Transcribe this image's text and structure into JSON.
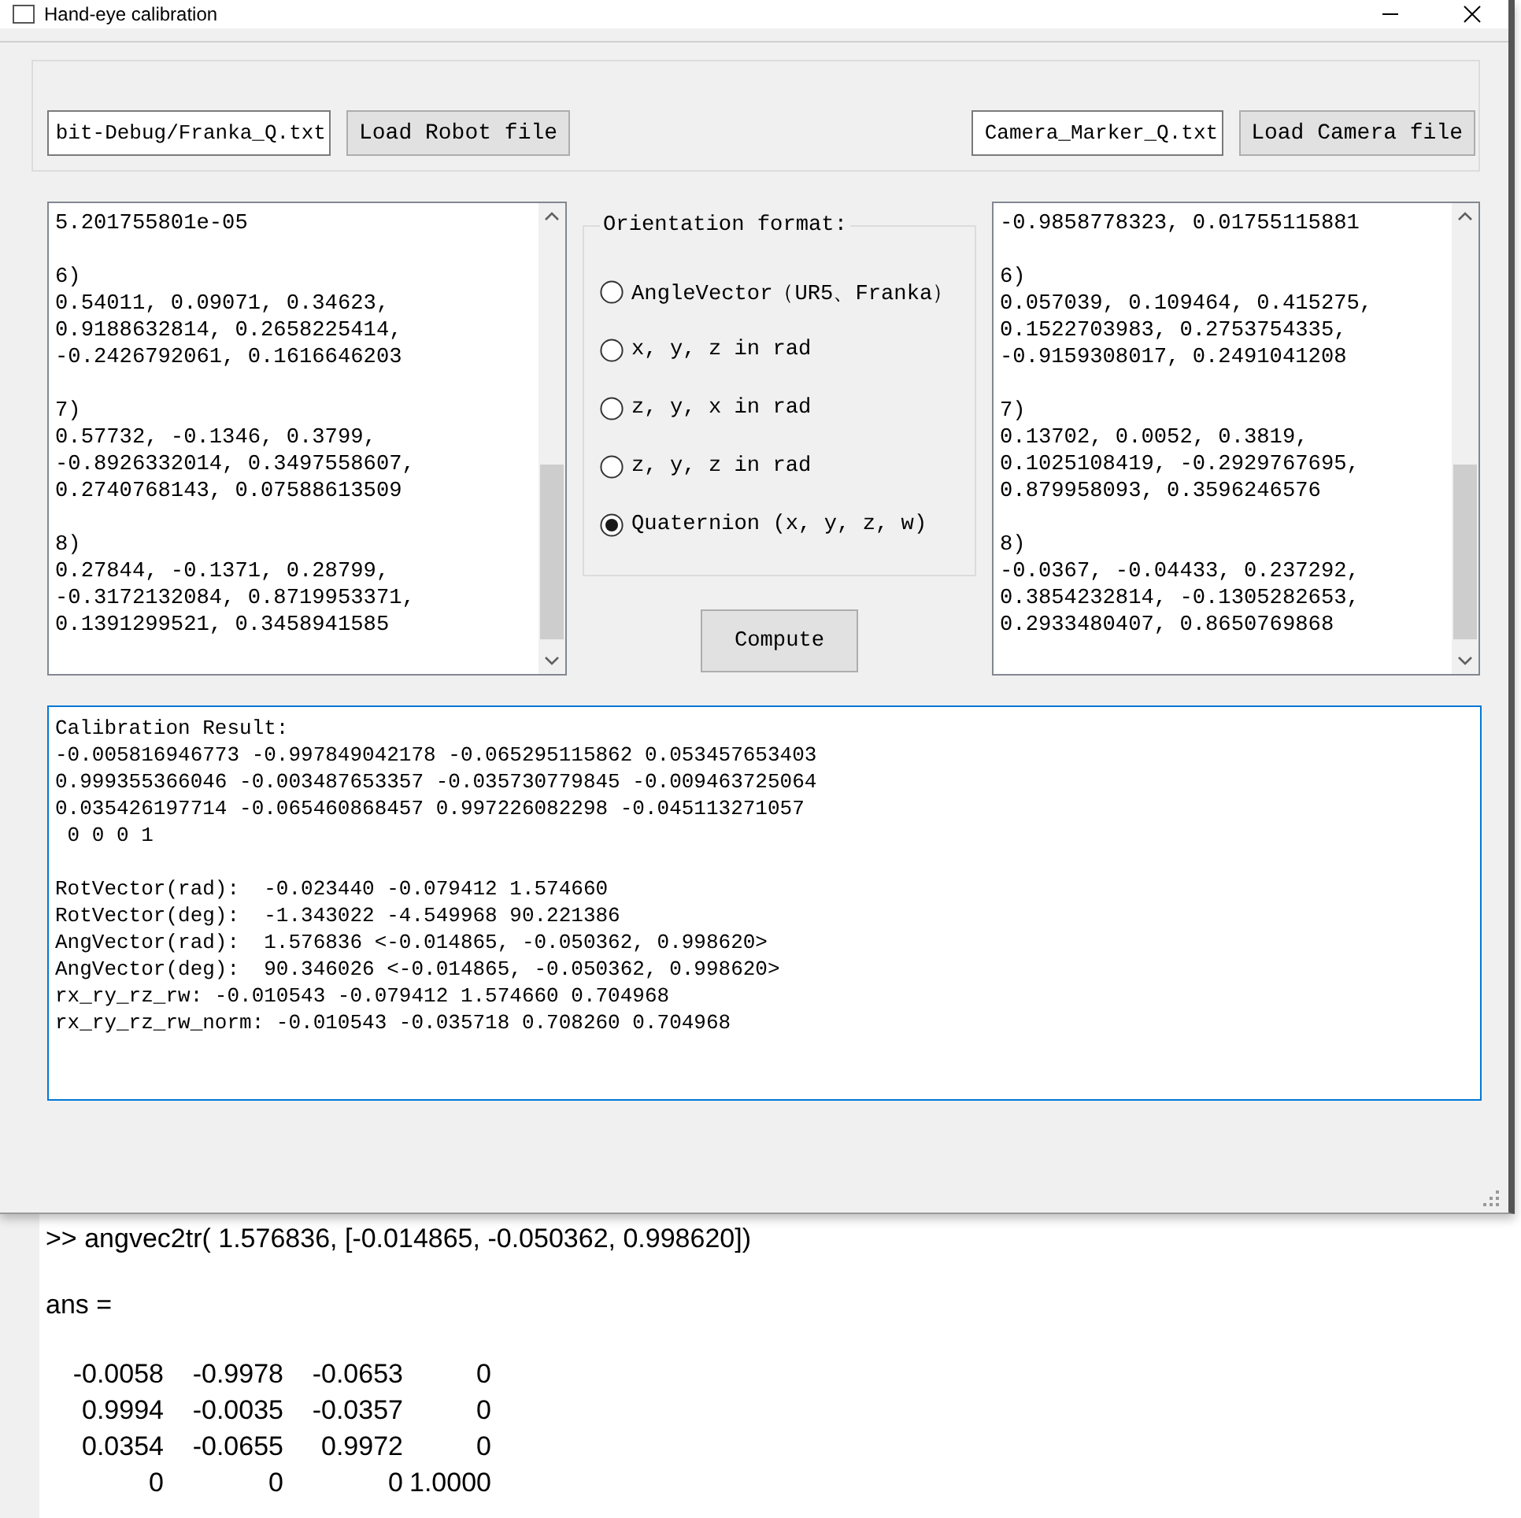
{
  "window": {
    "title": "Hand-eye calibration"
  },
  "robot_file": {
    "path": "bit-Debug/Franka_Q.txt",
    "button": "Load Robot file"
  },
  "camera_file": {
    "path": "Camera_Marker_Q.txt",
    "button": "Load Camera file"
  },
  "robot_data": {
    "blocks": [
      {
        "lines": [
          "5.201755801e-05"
        ]
      },
      {
        "lines": [
          "6)",
          "0.54011, 0.09071, 0.34623,",
          "0.9188632814, 0.2658225414,",
          "-0.2426792061, 0.1616646203"
        ]
      },
      {
        "lines": [
          "7)",
          "0.57732, -0.1346, 0.3799,",
          "-0.8926332014, 0.3497558607,",
          "0.2740768143, 0.07588613509"
        ]
      },
      {
        "lines": [
          "8)",
          "0.27844, -0.1371, 0.28799,",
          "-0.3172132084, 0.8719953371,",
          "0.1391299521, 0.3458941585"
        ]
      }
    ]
  },
  "orientation": {
    "title": "Orientation format:",
    "options": [
      {
        "label": "AngleVector（UR5、Franka）",
        "selected": false
      },
      {
        "label": "x, y, z in rad",
        "selected": false
      },
      {
        "label": "z, y, x in rad",
        "selected": false
      },
      {
        "label": "z, y, z in rad",
        "selected": false
      },
      {
        "label": "Quaternion (x, y, z, w)",
        "selected": true
      }
    ]
  },
  "compute_button": "Compute",
  "camera_data": {
    "blocks": [
      {
        "lines": [
          "-0.9858778323, 0.01755115881"
        ]
      },
      {
        "lines": [
          "6)",
          "0.057039, 0.109464, 0.415275,",
          "0.1522703983, 0.2753754335,",
          "-0.9159308017, 0.2491041208"
        ]
      },
      {
        "lines": [
          "7)",
          "0.13702, 0.0052, 0.3819,",
          "0.1025108419, -0.2929767695,",
          "0.879958093, 0.3596246576"
        ]
      },
      {
        "lines": [
          "8)",
          "-0.0367, -0.04433, 0.237292,",
          "0.3854232814, -0.1305282653,",
          "0.2933480407, 0.8650769868"
        ]
      }
    ]
  },
  "result": {
    "blocks": [
      {
        "lines": [
          "Calibration Result:",
          "-0.005816946773 -0.997849042178 -0.065295115862 0.053457653403",
          "0.999355366046 -0.003487653357 -0.035730779845 -0.009463725064",
          "0.035426197714 -0.065460868457 0.997226082298 -0.045113271057",
          " 0 0 0 1"
        ]
      },
      {
        "lines": [
          "RotVector(rad):  -0.023440 -0.079412 1.574660",
          "RotVector(deg):  -1.343022 -4.549968 90.221386",
          "AngVector(rad):  1.576836 <-0.014865, -0.050362, 0.998620>",
          "AngVector(deg):  90.346026 <-0.014865, -0.050362, 0.998620>",
          "rx_ry_rz_rw: -0.010543 -0.079412 1.574660 0.704968",
          "rx_ry_rz_rw_norm: -0.010543 -0.035718 0.708260 0.704968"
        ]
      }
    ]
  },
  "console": {
    "command": ">> angvec2tr( 1.576836, [-0.014865, -0.050362, 0.998620])",
    "answer": "ans =",
    "matrix": [
      [
        "-0.0058",
        "-0.9978",
        "-0.0653",
        "0"
      ],
      [
        "0.9994",
        "-0.0035",
        "-0.0357",
        "0"
      ],
      [
        "0.0354",
        "-0.0655",
        "0.9972",
        "0"
      ],
      [
        "0",
        "0",
        "0",
        "1.0000"
      ]
    ]
  }
}
